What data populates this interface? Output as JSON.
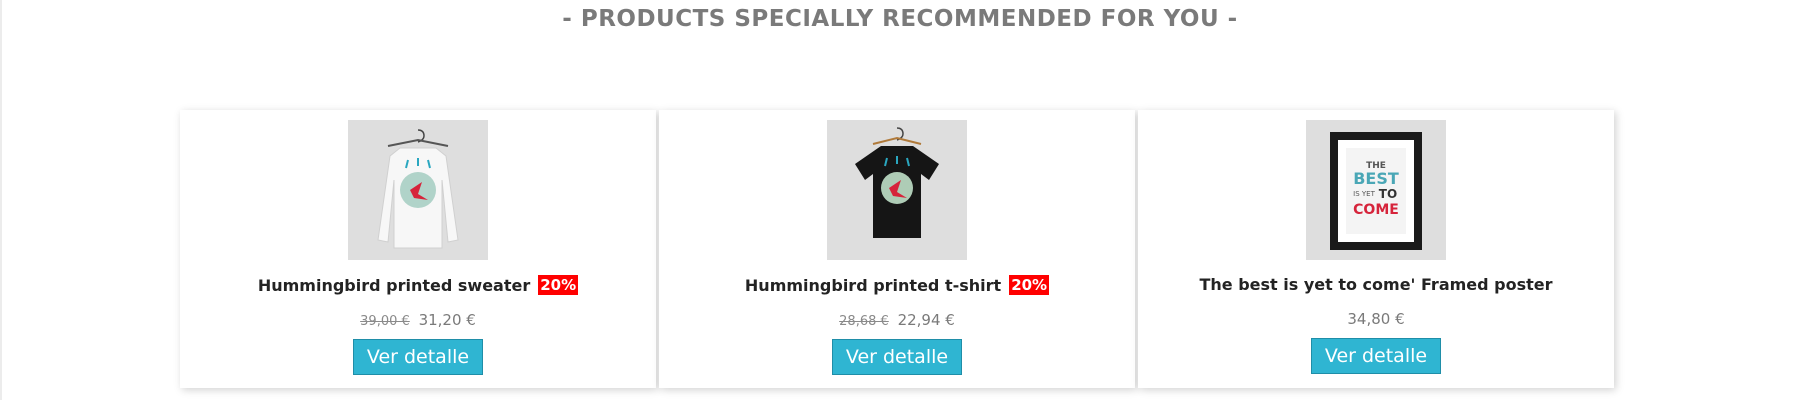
{
  "section": {
    "title": "- PRODUCTS SPECIALLY RECOMMENDED FOR YOU -"
  },
  "products": [
    {
      "name": "Hummingbird printed sweater",
      "discount": "20%",
      "old_price": "39,00 €",
      "price": "31,20 €",
      "button_label": "Ver detalle",
      "image_icon": "sweater-icon"
    },
    {
      "name": "Hummingbird printed t-shirt",
      "discount": "20%",
      "old_price": "28,68 €",
      "price": "22,94 €",
      "button_label": "Ver detalle",
      "image_icon": "tshirt-icon"
    },
    {
      "name": "The best is yet to come' Framed poster",
      "price": "34,80 €",
      "button_label": "Ver detalle",
      "image_icon": "framed-poster-icon",
      "poster_text": [
        "THE",
        "BEST",
        "IS YET",
        "TO",
        "COME"
      ]
    }
  ],
  "colors": {
    "accent": "#2fb5d2",
    "badge": "#ff0000",
    "title": "#7a7a7a"
  }
}
